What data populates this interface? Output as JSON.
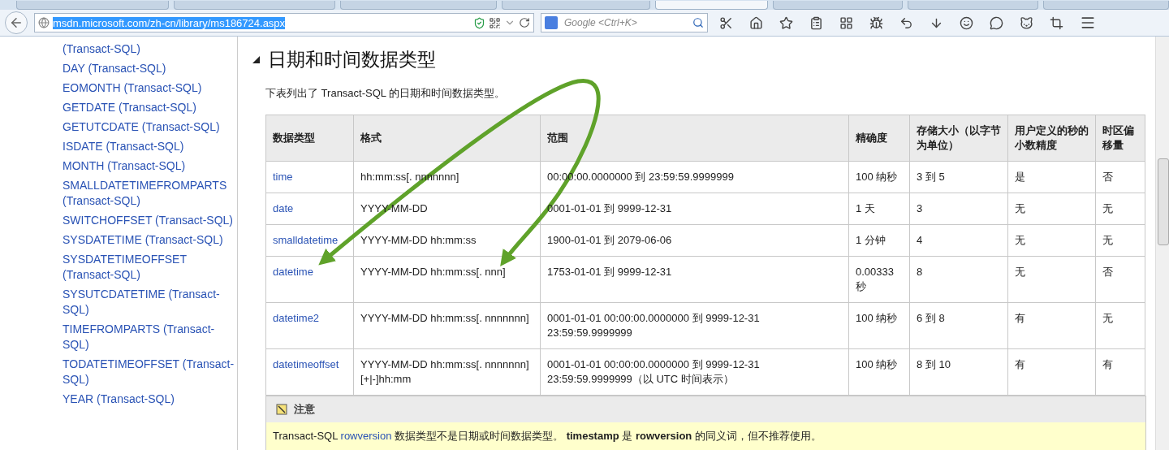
{
  "browser_tabs": [
    {
      "selected": false
    },
    {
      "selected": false
    },
    {
      "selected": false
    },
    {
      "selected": false
    },
    {
      "selected": true
    },
    {
      "selected": false
    },
    {
      "selected": false
    },
    {
      "selected": false
    }
  ],
  "address_bar": {
    "url": "msdn.microsoft.com/zh-cn/library/ms186724.aspx",
    "selected": true
  },
  "search": {
    "placeholder": "Google <Ctrl+K>"
  },
  "sidebar": {
    "items": [
      "(Transact-SQL)",
      "DAY (Transact-SQL)",
      "EOMONTH (Transact-SQL)",
      "GETDATE (Transact-SQL)",
      "GETUTCDATE (Transact-SQL)",
      "ISDATE (Transact-SQL)",
      "MONTH (Transact-SQL)",
      "SMALLDATETIMEFROMPARTS (Transact-SQL)",
      "SWITCHOFFSET (Transact-SQL)",
      "SYSDATETIME (Transact-SQL)",
      "SYSDATETIMEOFFSET (Transact-SQL)",
      "SYSUTCDATETIME (Transact-SQL)",
      "TIMEFROMPARTS (Transact-SQL)",
      "TODATETIMEOFFSET (Transact-SQL)",
      "YEAR (Transact-SQL)"
    ]
  },
  "section": {
    "title": "日期和时间数据类型",
    "expanded": true,
    "intro": "下表列出了 Transact-SQL 的日期和时间数据类型。"
  },
  "table": {
    "columns": [
      "数据类型",
      "格式",
      "范围",
      "精确度",
      "存储大小（以字节为单位）",
      "用户定义的秒的小数精度",
      "时区偏移量"
    ],
    "rows": [
      [
        "time",
        "hh:mm:ss[. nnnnnnn]",
        "00:00:00.0000000 到 23:59:59.9999999",
        "100 纳秒",
        "3 到 5",
        "是",
        "否"
      ],
      [
        "date",
        "YYYY-MM-DD",
        "0001-01-01 到 9999-12-31",
        "1 天",
        "3",
        "无",
        "无"
      ],
      [
        "smalldatetime",
        "YYYY-MM-DD hh:mm:ss",
        "1900-01-01 到 2079-06-06",
        "1 分钟",
        "4",
        "无",
        "无"
      ],
      [
        "datetime",
        "YYYY-MM-DD hh:mm:ss[. nnn]",
        "1753-01-01 到 9999-12-31",
        "0.00333 秒",
        "8",
        "无",
        "否"
      ],
      [
        "datetime2",
        "YYYY-MM-DD hh:mm:ss[. nnnnnnn]",
        "0001-01-01 00:00:00.0000000 到 9999-12-31 23:59:59.9999999",
        "100 纳秒",
        "6 到 8",
        "有",
        "无"
      ],
      [
        "datetimeoffset",
        "YYYY-MM-DD hh:mm:ss[. nnnnnnn] [+|-]hh:mm",
        "0001-01-01 00:00:00.0000000 到 9999-12-31 23:59:59.9999999（以 UTC 时间表示）",
        "100 纳秒",
        "8 到 10",
        "有",
        "有"
      ]
    ]
  },
  "note": {
    "title": "注意",
    "before": "Transact-SQL ",
    "link": "rowversion",
    "after": " 数据类型不是日期或时间数据类型。 **timestamp** 是 **rowversion** 的同义词，但不推荐使用。"
  }
}
